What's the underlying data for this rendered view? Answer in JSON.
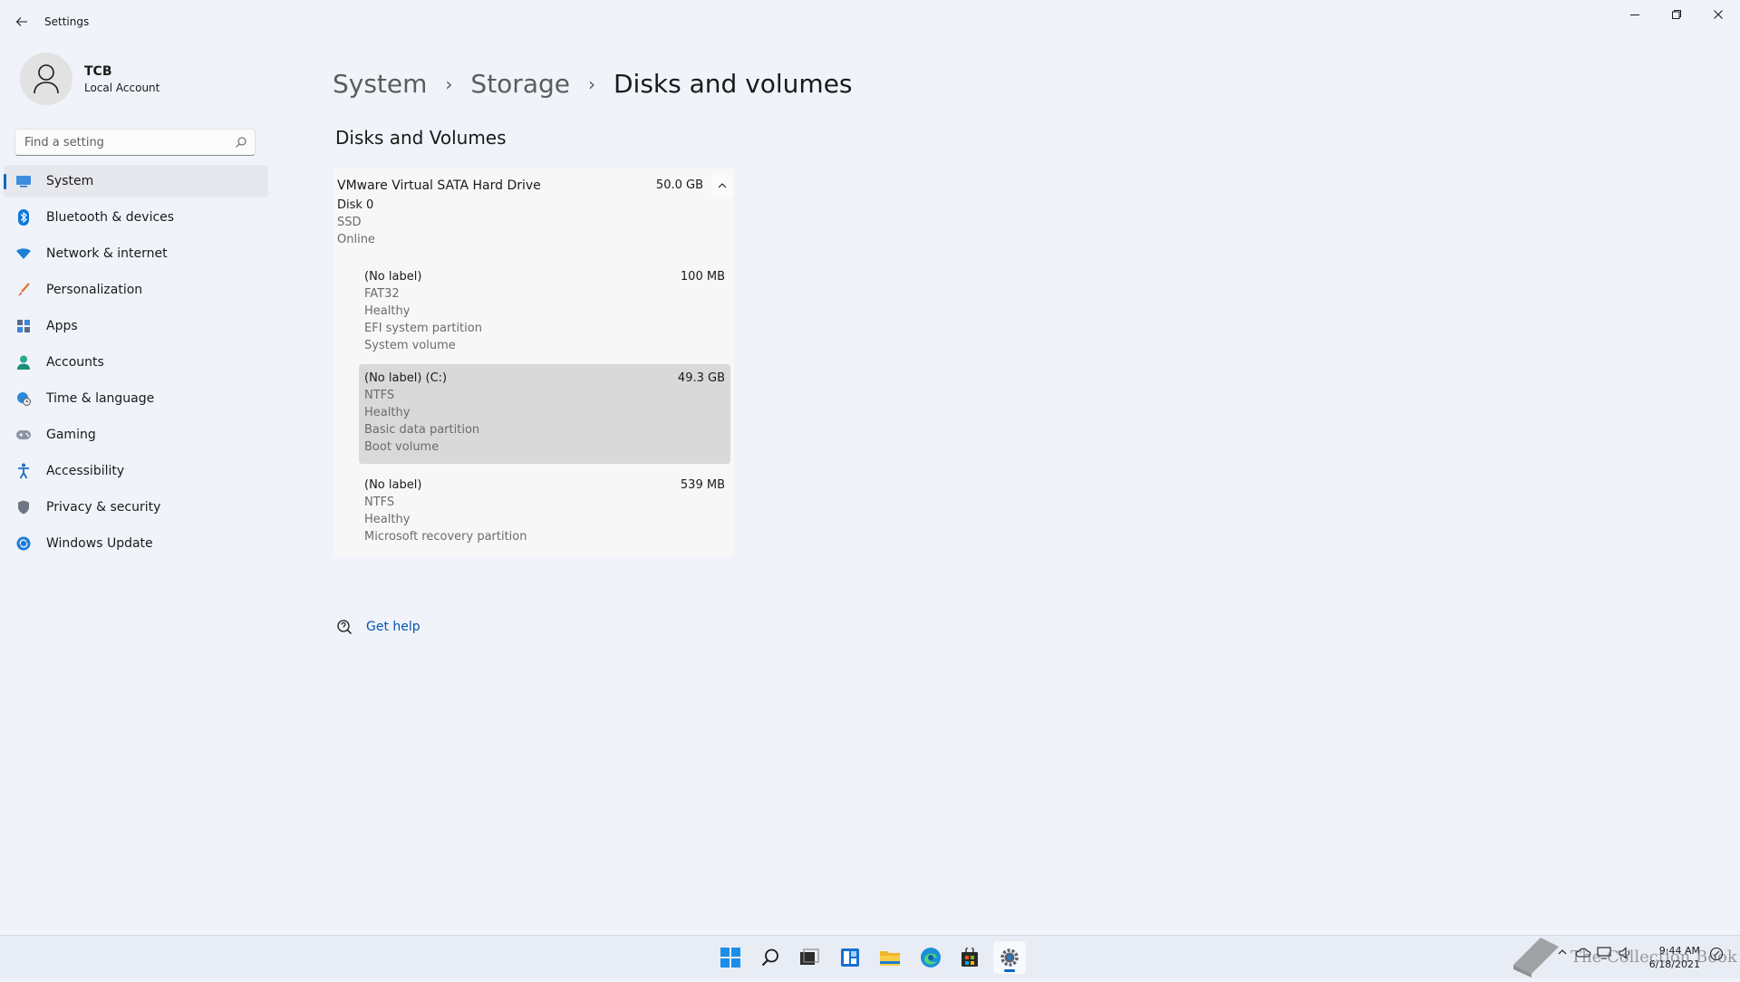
{
  "window": {
    "title": "Settings",
    "controls": {
      "minimize": "minimize-icon",
      "maximize": "restore-icon",
      "close": "close-icon"
    }
  },
  "profile": {
    "name": "TCB",
    "subtitle": "Local Account"
  },
  "search": {
    "placeholder": "Find a setting",
    "value": ""
  },
  "nav": {
    "items": [
      {
        "label": "System",
        "icon": "system-icon",
        "active": true
      },
      {
        "label": "Bluetooth & devices",
        "icon": "bluetooth-icon"
      },
      {
        "label": "Network & internet",
        "icon": "wifi-icon"
      },
      {
        "label": "Personalization",
        "icon": "brush-icon"
      },
      {
        "label": "Apps",
        "icon": "apps-icon"
      },
      {
        "label": "Accounts",
        "icon": "person-icon"
      },
      {
        "label": "Time & language",
        "icon": "globe-clock-icon"
      },
      {
        "label": "Gaming",
        "icon": "gamepad-icon"
      },
      {
        "label": "Accessibility",
        "icon": "accessibility-icon"
      },
      {
        "label": "Privacy & security",
        "icon": "shield-icon"
      },
      {
        "label": "Windows Update",
        "icon": "update-icon"
      }
    ]
  },
  "breadcrumb": {
    "items": [
      "System",
      "Storage"
    ],
    "current": "Disks and volumes",
    "separator": "›"
  },
  "section": {
    "title": "Disks and Volumes"
  },
  "disk": {
    "name": "VMware Virtual SATA Hard Drive",
    "size": "50.0 GB",
    "id": "Disk 0",
    "media": "SSD",
    "status": "Online",
    "volumes": [
      {
        "label": "(No label)",
        "size": "100 MB",
        "details": [
          "FAT32",
          "Healthy",
          "EFI system partition",
          "System volume"
        ]
      },
      {
        "label": "(No label) (C:)",
        "size": "49.3 GB",
        "details": [
          "NTFS",
          "Healthy",
          "Basic data partition",
          "Boot volume"
        ],
        "selected": true
      },
      {
        "label": "(No label)",
        "size": "539 MB",
        "details": [
          "NTFS",
          "Healthy",
          "Microsoft recovery partition"
        ]
      }
    ]
  },
  "help": {
    "label": "Get help"
  },
  "taskbar": {
    "apps": [
      "start-icon",
      "search-icon",
      "task-view-icon",
      "widgets-icon",
      "file-explorer-icon",
      "edge-icon",
      "store-icon",
      "settings-icon"
    ],
    "active_app": "settings-icon",
    "clock": {
      "time": "9:44 AM",
      "date": "6/18/2021"
    }
  },
  "watermark": {
    "text": "The Collection Book"
  },
  "colors": {
    "accent": "#0067c0",
    "background": "#f0f3f9",
    "link": "#0055b3"
  }
}
